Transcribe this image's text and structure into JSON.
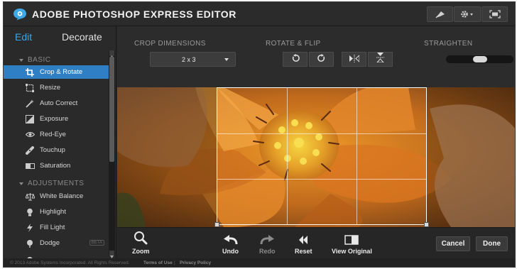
{
  "app": {
    "title": "ADOBE PHOTOSHOP EXPRESS EDITOR"
  },
  "header_buttons": [
    {
      "icon": "flag-icon"
    },
    {
      "icon": "gear-icon"
    },
    {
      "icon": "fullscreen-icon"
    }
  ],
  "sidebar": {
    "tabs": [
      {
        "label": "Edit",
        "active": true
      },
      {
        "label": "Decorate",
        "active": false
      }
    ],
    "sections": [
      {
        "title": "BASIC",
        "items": [
          {
            "label": "Crop & Rotate",
            "icon": "crop-icon",
            "selected": true
          },
          {
            "label": "Resize",
            "icon": "resize-icon"
          },
          {
            "label": "Auto Correct",
            "icon": "magic-wand-icon"
          },
          {
            "label": "Exposure",
            "icon": "exposure-icon"
          },
          {
            "label": "Red-Eye",
            "icon": "eye-icon"
          },
          {
            "label": "Touchup",
            "icon": "bandage-icon"
          },
          {
            "label": "Saturation",
            "icon": "saturation-icon"
          }
        ]
      },
      {
        "title": "ADJUSTMENTS",
        "items": [
          {
            "label": "White Balance",
            "icon": "scale-icon"
          },
          {
            "label": "Highlight",
            "icon": "bulb-icon"
          },
          {
            "label": "Fill Light",
            "icon": "lightning-icon"
          },
          {
            "label": "Dodge",
            "icon": "dodge-icon",
            "badge": "BETA"
          }
        ]
      }
    ]
  },
  "toolbar": {
    "crop_dimensions_label": "CROP DIMENSIONS",
    "crop_dimensions_value": "2 x 3",
    "rotate_flip_label": "ROTATE & FLIP",
    "straighten_label": "STRAIGHTEN",
    "straighten_value": 0.5
  },
  "bottom_bar": {
    "zoom": "Zoom",
    "undo": "Undo",
    "redo": "Redo",
    "reset": "Reset",
    "view_original": "View Original",
    "cancel": "Cancel",
    "done": "Done"
  },
  "footer": {
    "copyright": "© 2013 Adobe Systems Incorporated. All Rights Reserved.",
    "terms": "Terms of Use",
    "separator": "|",
    "privacy": "Privacy Policy"
  },
  "colors": {
    "accent": "#39a8e6",
    "selected_bg": "#2e7fc4",
    "panel": "#2a2a2a"
  }
}
